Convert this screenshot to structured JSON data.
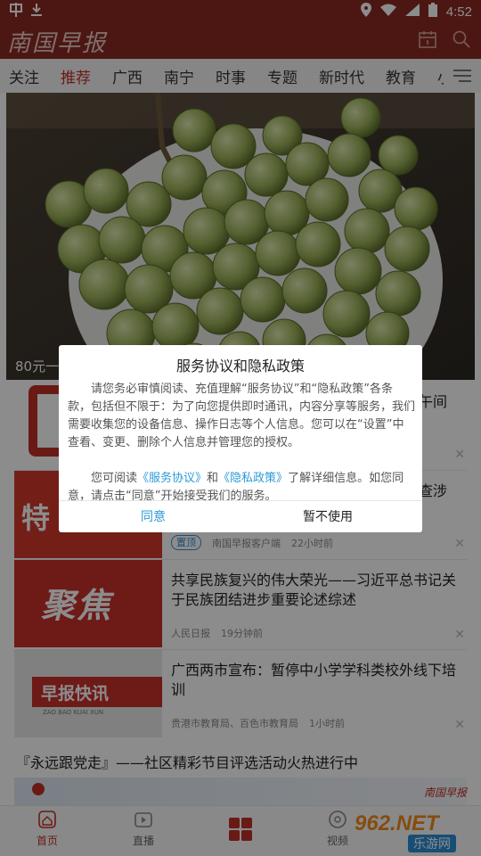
{
  "status_bar": {
    "time": "4:52",
    "left_icons": [
      "app-notification-icon",
      "download-icon"
    ],
    "right_icons": [
      "location-icon",
      "wifi-icon",
      "signal-icon",
      "battery-icon"
    ]
  },
  "header": {
    "logo": "南国早报",
    "icons": [
      "calendar-icon",
      "search-icon"
    ]
  },
  "tabs": [
    "关注",
    "推荐",
    "广西",
    "南宁",
    "时事",
    "专题",
    "新时代",
    "教育",
    "小说"
  ],
  "active_tab": "推荐",
  "hero": {
    "caption": "80元一"
  },
  "feed": [
    {
      "title": "午间",
      "thumb_label": "特",
      "meta": {
        "source": "",
        "time": ""
      }
    },
    {
      "title": "查涉",
      "thumb_label": "特",
      "meta": {
        "tag": "置顶",
        "source": "南国早报客户端",
        "time": "22小时前"
      }
    },
    {
      "title": "共享民族复兴的伟大荣光——习近平总书记关于民族团结进步重要论述综述",
      "thumb_label": "聚焦",
      "meta": {
        "source": "人民日报",
        "time": "19分钟前"
      }
    },
    {
      "title": "广西两市宣布：暂停中小学学科类校外线下培训",
      "thumb_label": "早报快讯",
      "thumb_sub": "ZAO BAO KUAI XUN",
      "meta": {
        "source": "贵港市教育局、百色市教育局",
        "time": "1小时前"
      }
    }
  ],
  "section_title": "『永远跟党走』——社区精彩节目评选活动火热进行中",
  "banner_text": "南国早报",
  "dialog": {
    "title": "服务协议和隐私政策",
    "para1": "请您务必审慎阅读、充值理解“服务协议”和“隐私政策”各条款，包括但不限于：为了向您提供即时通讯，内容分享等服务，我们需要收集您的设备信息、操作日志等个人信息。您可以在“设置”中查看、变更、删除个人信息并管理您的授权。",
    "para2_a": "您可阅读",
    "link1": "《服务协议》",
    "para2_b": "和",
    "link2": "《隐私政策》",
    "para2_c": "了解详细信息。如您同意，请点击“同意”开始接受我们的服务。",
    "agree": "同意",
    "decline": "暂不使用"
  },
  "bottom_nav": [
    {
      "label": "首页",
      "icon": "home-icon"
    },
    {
      "label": "直播",
      "icon": "tv-icon"
    },
    {
      "label": "",
      "icon": "grid-icon"
    },
    {
      "label": "视频",
      "icon": "video-icon"
    }
  ],
  "watermark": {
    "text1": "962.NET",
    "text2": "乐游网"
  },
  "colors": {
    "brand_red": "#8a2a22",
    "accent_red": "#c23026",
    "link_blue": "#2c9ad8"
  }
}
